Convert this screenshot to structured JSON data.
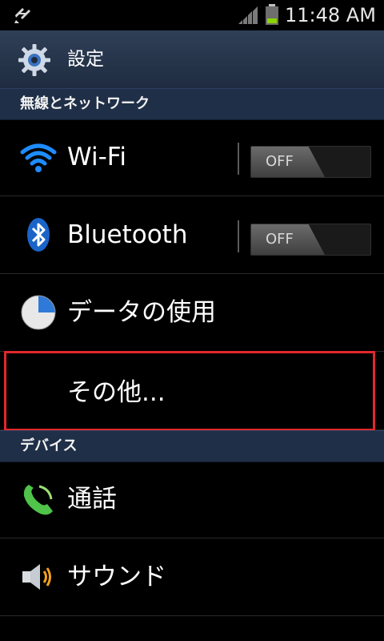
{
  "status_bar": {
    "time": "11:48 AM",
    "icons": [
      "usb-debug-icon",
      "signal-icon",
      "battery-icon"
    ]
  },
  "title_bar": {
    "title": "設定",
    "icon": "gear-icon"
  },
  "sections": [
    {
      "header": "無線とネットワーク",
      "items": [
        {
          "label": "Wi-Fi",
          "icon": "wifi-icon",
          "toggle": "OFF"
        },
        {
          "label": "Bluetooth",
          "icon": "bluetooth-icon",
          "toggle": "OFF"
        },
        {
          "label": "データの使用",
          "icon": "data-usage-icon"
        },
        {
          "label": "その他...",
          "icon": ""
        }
      ]
    },
    {
      "header": "デバイス",
      "items": [
        {
          "label": "通話",
          "icon": "phone-icon"
        },
        {
          "label": "サウンド",
          "icon": "speaker-icon"
        }
      ]
    }
  ],
  "colors": {
    "section_bg": "#1f2f48",
    "title_bg": "#2f3f57",
    "highlight": "#e0282c",
    "wifi_blue": "#1e8cff",
    "phone_green": "#4fc34a",
    "speaker_orange": "#f2a11f"
  }
}
